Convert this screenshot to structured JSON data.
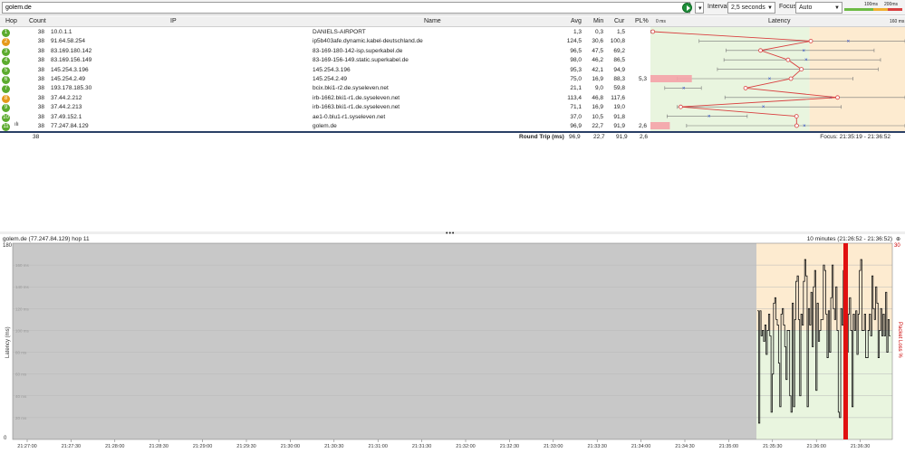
{
  "toolbar": {
    "target": "golem.de",
    "interval_label": "Interval",
    "interval_value": "2,5 seconds",
    "focus_label": "Focus",
    "focus_value": "Auto",
    "scale_100": "100ms",
    "scale_200": "200ms"
  },
  "columns": {
    "hop": "Hop",
    "count": "Count",
    "ip": "IP",
    "name": "Name",
    "avg": "Avg",
    "min": "Min",
    "cur": "Cur",
    "pl": "PL%",
    "latency": "Latency",
    "zero": "0 ms",
    "max": "160 ms"
  },
  "rows": [
    {
      "hop": "1",
      "count": "38",
      "ip": "10.0.1.1",
      "name": "DANIELS-AIRPORT",
      "avg": "1,3",
      "min": "0,3",
      "cur": "1,5",
      "pl": "",
      "color": "#5cab2e"
    },
    {
      "hop": "2",
      "count": "38",
      "ip": "91.64.58.254",
      "name": "ip5b403afe.dynamic.kabel-deutschland.de",
      "avg": "124,5",
      "min": "30,6",
      "cur": "100,8",
      "pl": "",
      "color": "#e69a1a"
    },
    {
      "hop": "3",
      "count": "38",
      "ip": "83.169.180.142",
      "name": "83-169-180-142-isp.superkabel.de",
      "avg": "96,5",
      "min": "47,5",
      "cur": "69,2",
      "pl": "",
      "color": "#5cab2e"
    },
    {
      "hop": "4",
      "count": "38",
      "ip": "83.169.156.149",
      "name": "83-169-156-149.static.superkabel.de",
      "avg": "98,0",
      "min": "46,2",
      "cur": "86,5",
      "pl": "",
      "color": "#5cab2e"
    },
    {
      "hop": "5",
      "count": "38",
      "ip": "145.254.3.196",
      "name": "145.254.3.196",
      "avg": "95,3",
      "min": "42,1",
      "cur": "94,9",
      "pl": "",
      "color": "#5cab2e"
    },
    {
      "hop": "6",
      "count": "38",
      "ip": "145.254.2.49",
      "name": "145.254.2.49",
      "avg": "75,0",
      "min": "16,9",
      "cur": "88,3",
      "pl": "5,3",
      "color": "#5cab2e"
    },
    {
      "hop": "7",
      "count": "38",
      "ip": "193.178.185.30",
      "name": "bcix.bki1-r2.de.syseleven.net",
      "avg": "21,1",
      "min": "9,0",
      "cur": "59,8",
      "pl": "",
      "color": "#5cab2e"
    },
    {
      "hop": "8",
      "count": "38",
      "ip": "37.44.2.212",
      "name": "irb-1662.bki1-r1.de.syseleven.net",
      "avg": "113,4",
      "min": "46,8",
      "cur": "117,6",
      "pl": "",
      "color": "#e69a1a"
    },
    {
      "hop": "9",
      "count": "38",
      "ip": "37.44.2.213",
      "name": "irb-1663.bki1-r1.de.syseleven.net",
      "avg": "71,1",
      "min": "16,9",
      "cur": "19,0",
      "pl": "",
      "color": "#5cab2e"
    },
    {
      "hop": "10",
      "count": "38",
      "ip": "37.49.152.1",
      "name": "ae1-0.blu1-r1.syseleven.net",
      "avg": "37,0",
      "min": "10,5",
      "cur": "91,8",
      "pl": "",
      "color": "#5cab2e"
    },
    {
      "hop": "11",
      "count": "38",
      "ip": "77.247.84.129",
      "name": "golem.de",
      "avg": "96,9",
      "min": "22,7",
      "cur": "91,9",
      "pl": "2,6",
      "color": "#5cab2e"
    }
  ],
  "footer": {
    "count": "38",
    "label": "Round Trip (ms)",
    "avg": "96,9",
    "min": "22,7",
    "cur": "91,9",
    "pl": "2,6",
    "focus": "Focus: 21:35:19 - 21:36:52"
  },
  "lower": {
    "title": "golem.de (77.247.84.129) hop 11",
    "range": "10 minutes (21:26:52 - 21:36:52)",
    "y_label": "Latency (ms)",
    "y2_label": "Packet Loss %",
    "y_max": "180",
    "y_min": "0",
    "y2_max": "30",
    "y_ticks": [
      "160 ms",
      "140 ms",
      "120 ms",
      "100 ms",
      "80 ms",
      "60 ms",
      "40 ms",
      "20 ms"
    ],
    "x_ticks": [
      "21:27:00",
      "21:27:30",
      "21:28:00",
      "21:28:30",
      "21:29:00",
      "21:29:30",
      "21:30:00",
      "21:30:30",
      "21:31:00",
      "21:31:30",
      "21:32:00",
      "21:32:30",
      "21:33:00",
      "21:33:30",
      "21:34:00",
      "21:34:30",
      "21:35:00",
      "21:35:30",
      "21:36:00",
      "21:36:30"
    ],
    "series": [
      118,
      15,
      118,
      95,
      100,
      90,
      105,
      78,
      100,
      115,
      95,
      25,
      60,
      125,
      130,
      110,
      105,
      70,
      30,
      115,
      120,
      105,
      85,
      55,
      100,
      100,
      40,
      25,
      125,
      30,
      110,
      145,
      150,
      110,
      40,
      115,
      105,
      145,
      165,
      150,
      30,
      120,
      105,
      135,
      85,
      140,
      155,
      45,
      125,
      90,
      100,
      110,
      110,
      160,
      155,
      115,
      75,
      118,
      80,
      130,
      160,
      120,
      110,
      140,
      100,
      25,
      20,
      120,
      105,
      155,
      20,
      20,
      80,
      115,
      130,
      100,
      30,
      115,
      100,
      118,
      78,
      115,
      155,
      165,
      100,
      100,
      115,
      75,
      75,
      100,
      115,
      95,
      150,
      120,
      110,
      140,
      125,
      75,
      100,
      120,
      95,
      115,
      95,
      135,
      80,
      110,
      95
    ],
    "loss_time_fraction": 0.64
  }
}
